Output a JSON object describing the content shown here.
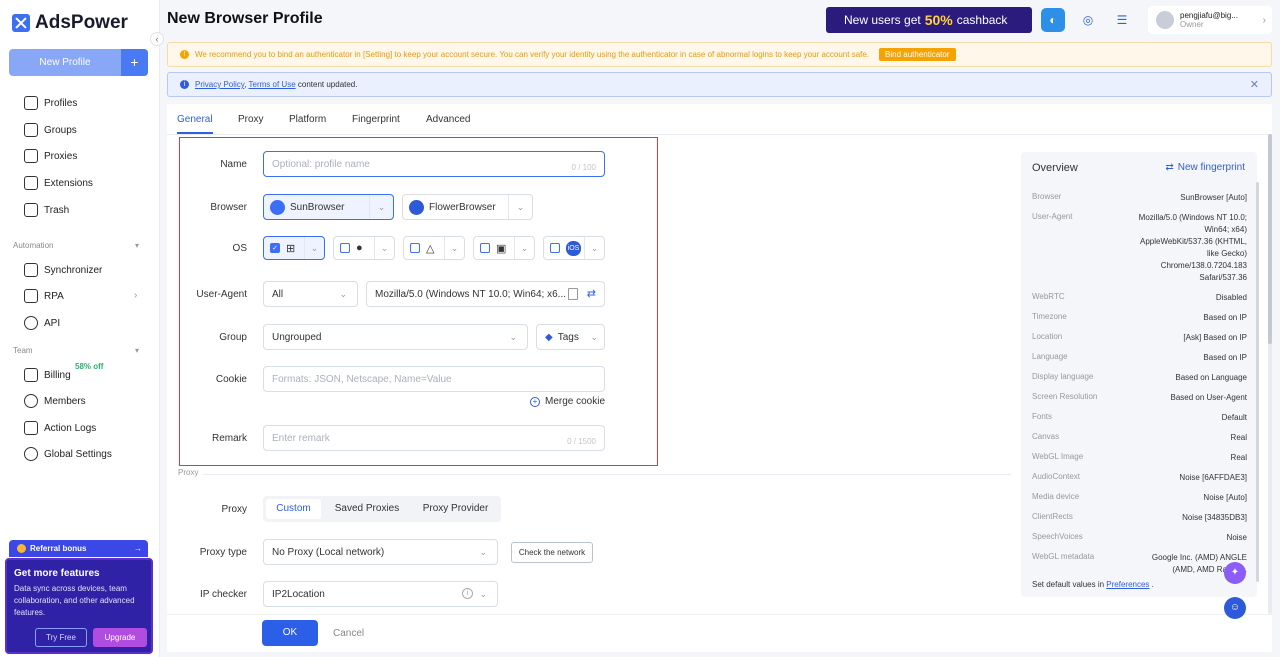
{
  "app": {
    "logo_text": "AdsPower",
    "page_title": "New Browser Profile",
    "new_profile_label": "New Profile"
  },
  "header": {
    "cashback_pre": "New users get",
    "cashback_pct": "50%",
    "cashback_post": "cashback",
    "user_email": "pengjiafu@big...",
    "user_role": "Owner"
  },
  "sidebar": {
    "main_items": [
      {
        "label": "Profiles",
        "icon": "profiles-icon"
      },
      {
        "label": "Groups",
        "icon": "groups-icon"
      },
      {
        "label": "Proxies",
        "icon": "proxies-icon"
      },
      {
        "label": "Extensions",
        "icon": "extensions-icon"
      },
      {
        "label": "Trash",
        "icon": "trash-icon"
      }
    ],
    "automation_label": "Automation",
    "automation_items": [
      {
        "label": "Synchronizer"
      },
      {
        "label": "RPA"
      },
      {
        "label": "API"
      }
    ],
    "team_label": "Team",
    "team_items": [
      {
        "label": "Billing"
      },
      {
        "label": "Members"
      },
      {
        "label": "Action Logs"
      },
      {
        "label": "Global Settings"
      }
    ],
    "billing_badge": "58% off",
    "referral": "Referral bonus",
    "promo_title": "Get more features",
    "promo_text": "Data sync across devices, team collaboration, and other advanced features.",
    "try_free": "Try Free",
    "upgrade": "Upgrade"
  },
  "banners": {
    "warning": "We recommend you to bind an authenticator in [Setting] to keep your account secure. You can verify your identity using the authenticator in case of abnormal logins to keep your account safe.",
    "bind_btn": "Bind authenticator",
    "info_privacy": "Privacy Policy",
    "info_sep": ",",
    "info_terms": "Terms of Use",
    "info_rest": "content updated."
  },
  "tabs": [
    "General",
    "Proxy",
    "Platform",
    "Fingerprint",
    "Advanced"
  ],
  "form": {
    "name_label": "Name",
    "name_placeholder": "Optional: profile name",
    "name_count": "0 / 100",
    "browser_label": "Browser",
    "browser1": "SunBrowser",
    "browser2": "FlowerBrowser",
    "os_label": "OS",
    "os_ios": "iOS",
    "ua_label": "User-Agent",
    "ua_select": "All",
    "ua_value": "Mozilla/5.0 (Windows NT 10.0; Win64; x6...",
    "group_label": "Group",
    "group_value": "Ungrouped",
    "tags_label": "Tags",
    "cookie_label": "Cookie",
    "cookie_placeholder": "Formats: JSON, Netscape, Name=Value",
    "merge_cookie": "Merge cookie",
    "remark_label": "Remark",
    "remark_placeholder": "Enter remark",
    "remark_count": "0 / 1500",
    "proxy_section": "Proxy",
    "proxy_label": "Proxy",
    "proxy_tabs": [
      "Custom",
      "Saved Proxies",
      "Proxy Provider"
    ],
    "proxy_type_label": "Proxy type",
    "proxy_type_value": "No Proxy (Local network)",
    "check_network": "Check the network",
    "ip_checker_label": "IP checker",
    "ip_checker_value": "IP2Location"
  },
  "footer": {
    "ok": "OK",
    "cancel": "Cancel"
  },
  "overview": {
    "title": "Overview",
    "new_fingerprint": "New fingerprint",
    "rows": [
      {
        "k": "Browser",
        "v": "SunBrowser [Auto]"
      },
      {
        "k": "User-Agent",
        "v": "Mozilla/5.0 (Windows NT 10.0; Win64; x64) AppleWebKit/537.36 (KHTML, like Gecko) Chrome/138.0.7204.183 Safari/537.36"
      },
      {
        "k": "WebRTC",
        "v": "Disabled"
      },
      {
        "k": "Timezone",
        "v": "Based on IP"
      },
      {
        "k": "Location",
        "v": "[Ask] Based on IP"
      },
      {
        "k": "Language",
        "v": "Based on IP"
      },
      {
        "k": "Display language",
        "v": "Based on Language"
      },
      {
        "k": "Screen Resolution",
        "v": "Based on User-Agent"
      },
      {
        "k": "Fonts",
        "v": "Default"
      },
      {
        "k": "Canvas",
        "v": "Real"
      },
      {
        "k": "WebGL Image",
        "v": "Real"
      },
      {
        "k": "AudioContext",
        "v": "Noise [6AFFDAE3]"
      },
      {
        "k": "Media device",
        "v": "Noise [Auto]"
      },
      {
        "k": "ClientRects",
        "v": "Noise [34835DB3]"
      },
      {
        "k": "SpeechVoices",
        "v": "Noise"
      },
      {
        "k": "WebGL metadata",
        "v": "Google Inc. (AMD) ANGLE (AMD, AMD Radeo..."
      }
    ],
    "footer_pre": "Set default values in",
    "footer_link": "Preferences",
    "footer_post": "."
  },
  "colors": {
    "accent": "#3060e0",
    "warning": "#f4a300",
    "error_border": "#e0393e"
  }
}
